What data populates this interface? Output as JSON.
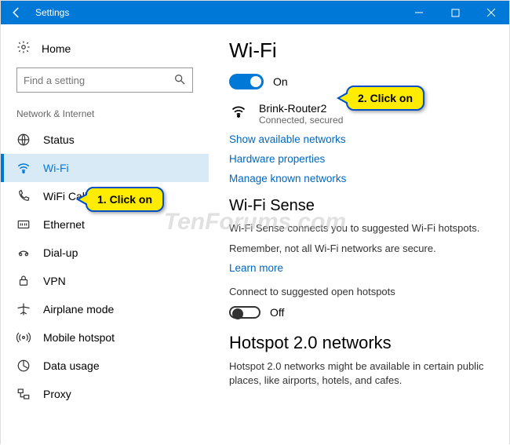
{
  "titlebar": {
    "title": "Settings"
  },
  "sidebar": {
    "home_label": "Home",
    "search_placeholder": "Find a setting",
    "section_label": "Network & Internet",
    "items": [
      {
        "label": "Status"
      },
      {
        "label": "Wi-Fi"
      },
      {
        "label": "WiFi Calling"
      },
      {
        "label": "Ethernet"
      },
      {
        "label": "Dial-up"
      },
      {
        "label": "VPN"
      },
      {
        "label": "Airplane mode"
      },
      {
        "label": "Mobile hotspot"
      },
      {
        "label": "Data usage"
      },
      {
        "label": "Proxy"
      }
    ]
  },
  "main": {
    "heading": "Wi-Fi",
    "toggle_on_label": "On",
    "network": {
      "name": "Brink-Router2",
      "status": "Connected, secured"
    },
    "link_show_networks": "Show available networks",
    "link_hardware_props": "Hardware properties",
    "link_manage_known": "Manage known networks",
    "sense_heading": "Wi-Fi Sense",
    "sense_desc": "Wi-Fi Sense connects you to suggested Wi-Fi hotspots.",
    "sense_note": "Remember, not all Wi-Fi networks are secure.",
    "link_learn_more": "Learn more",
    "connect_suggested_label": "Connect to suggested open hotspots",
    "toggle_off_label": "Off",
    "hotspot_heading": "Hotspot 2.0 networks",
    "hotspot_desc": "Hotspot 2.0 networks might be available in certain public places, like airports, hotels, and cafes."
  },
  "callouts": {
    "one": "1. Click on",
    "two": "2. Click on"
  },
  "watermark": "TenForums.com"
}
